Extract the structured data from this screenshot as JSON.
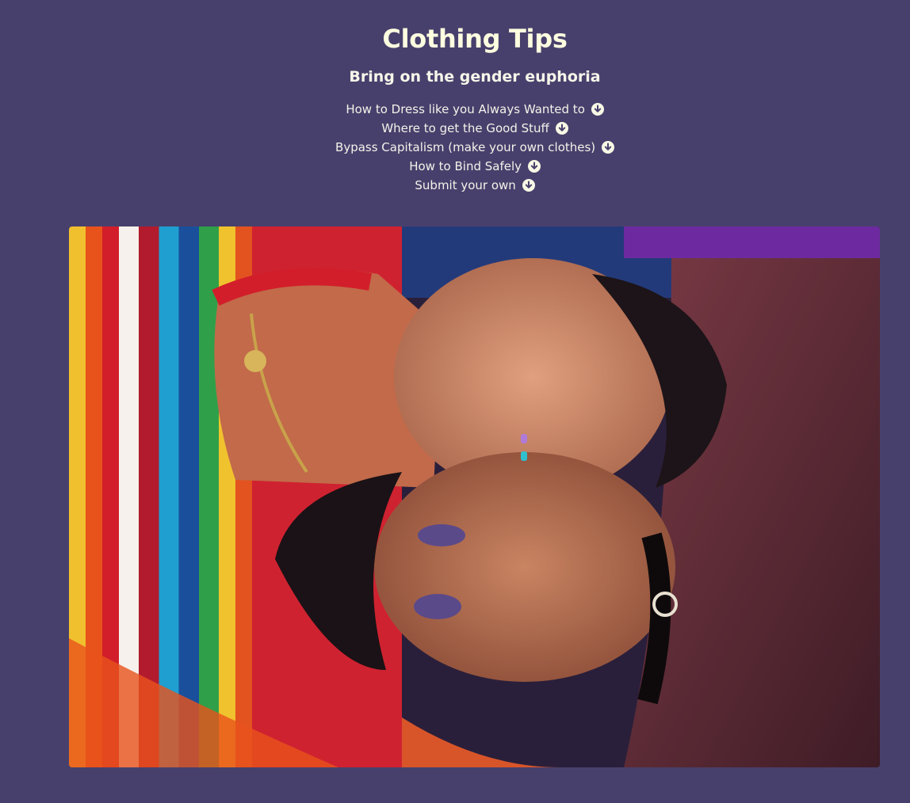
{
  "header": {
    "title": "Clothing Tips",
    "subtitle": "Bring on the gender euphoria"
  },
  "nav": {
    "items": [
      {
        "label": "How to Dress like you Always Wanted to",
        "icon": "arrow-down-circle-icon"
      },
      {
        "label": "Where to get the Good Stuff",
        "icon": "arrow-down-circle-icon"
      },
      {
        "label": "Bypass Capitalism (make your own clothes)",
        "icon": "arrow-down-circle-icon"
      },
      {
        "label": "How to Bind Safely",
        "icon": "arrow-down-circle-icon"
      },
      {
        "label": "Submit your own",
        "icon": "arrow-down-circle-icon"
      }
    ]
  },
  "colors": {
    "background": "#48406c",
    "text": "#fcfcea"
  }
}
